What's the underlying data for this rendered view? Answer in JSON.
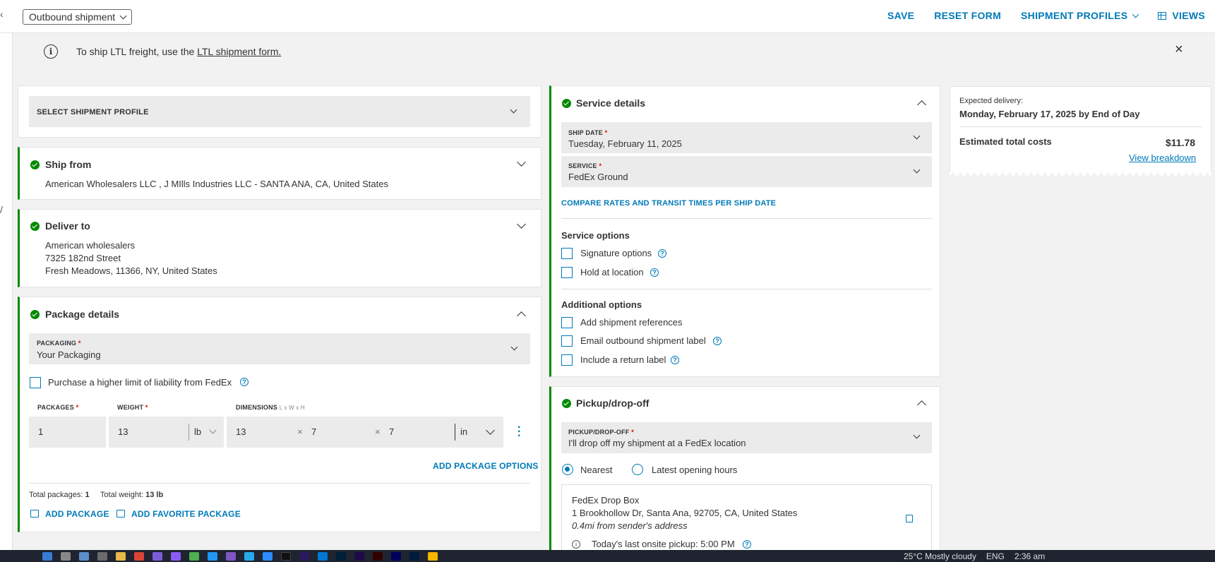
{
  "topbar": {
    "shipment_type": "Outbound shipment",
    "actions": {
      "save": "SAVE",
      "reset": "RESET FORM",
      "profiles": "SHIPMENT PROFILES",
      "views": "VIEWS"
    }
  },
  "banner": {
    "text_prefix": "To ship LTL freight, use the ",
    "link": "LTL shipment form."
  },
  "profile": {
    "label": "SELECT SHIPMENT PROFILE"
  },
  "ship_from": {
    "title": "Ship from",
    "address": "American Wholesalers LLC , J MIlls Industries LLC - SANTA ANA, CA, United States"
  },
  "deliver_to": {
    "title": "Deliver to",
    "line1": "American wholesalers",
    "line2": "7325 182nd Street",
    "line3": "Fresh Meadows, 11366, NY, United States"
  },
  "package": {
    "title": "Package details",
    "packaging_label": "PACKAGING",
    "packaging_value": "Your Packaging",
    "liability_label": "Purchase a higher limit of liability from FedEx",
    "packages_label": "PACKAGES",
    "weight_label": "WEIGHT",
    "dimensions_label": "DIMENSIONS",
    "dimensions_hint": "L x W x H",
    "packages_value": "1",
    "weight_value": "13",
    "weight_unit": "lb",
    "length": "13",
    "width": "7",
    "height": "7",
    "dim_unit": "in",
    "times": "×",
    "add_options": "ADD PACKAGE OPTIONS",
    "total_packages_label": "Total packages:",
    "total_packages_value": "1",
    "total_weight_label": "Total weight:",
    "total_weight_value": "13 lb",
    "add_package": "ADD PACKAGE",
    "add_favorite": "ADD FAVORITE PACKAGE"
  },
  "service": {
    "title": "Service details",
    "ship_date_label": "SHIP DATE",
    "ship_date_value": "Tuesday, February 11, 2025",
    "service_label": "SERVICE",
    "service_value": "FedEx Ground",
    "compare_link": "COMPARE RATES AND TRANSIT TIMES PER SHIP DATE",
    "service_options_heading": "Service options",
    "signature": "Signature options",
    "hold": "Hold at location",
    "additional_heading": "Additional options",
    "references": "Add shipment references",
    "email_label": "Email outbound shipment label",
    "return_label": "Include a return label"
  },
  "pickup": {
    "title": "Pickup/drop-off",
    "field_label": "PICKUP/DROP-OFF",
    "field_value": "I'll drop off my shipment at a FedEx location",
    "nearest": "Nearest",
    "latest": "Latest opening hours",
    "location_name": "FedEx Drop Box",
    "location_address": "1 Brookhollow Dr, Santa Ana, 92705, CA, United States",
    "location_distance": "0.4mi from sender's address",
    "pickup_note": "Today's last onsite pickup: 5:00 PM"
  },
  "summary": {
    "expected_label": "Expected delivery:",
    "expected_value": "Monday, February 17, 2025 by End of Day",
    "cost_label": "Estimated total costs",
    "cost_value": "$11.78",
    "breakdown_link": "View breakdown"
  },
  "taskbar": {
    "weather": "25°C  Mostly cloudy",
    "language": "ENG",
    "time": "2:36 am"
  },
  "colors": {
    "accent": "#007ab7",
    "success": "#008a00",
    "required": "#d00000"
  },
  "icons": [
    "info-icon",
    "close-icon",
    "checkmark-icon",
    "chevron-down-icon",
    "chevron-up-icon",
    "help-icon",
    "grid-icon",
    "copy-icon",
    "kebab-menu-icon",
    "package-add-icon"
  ]
}
